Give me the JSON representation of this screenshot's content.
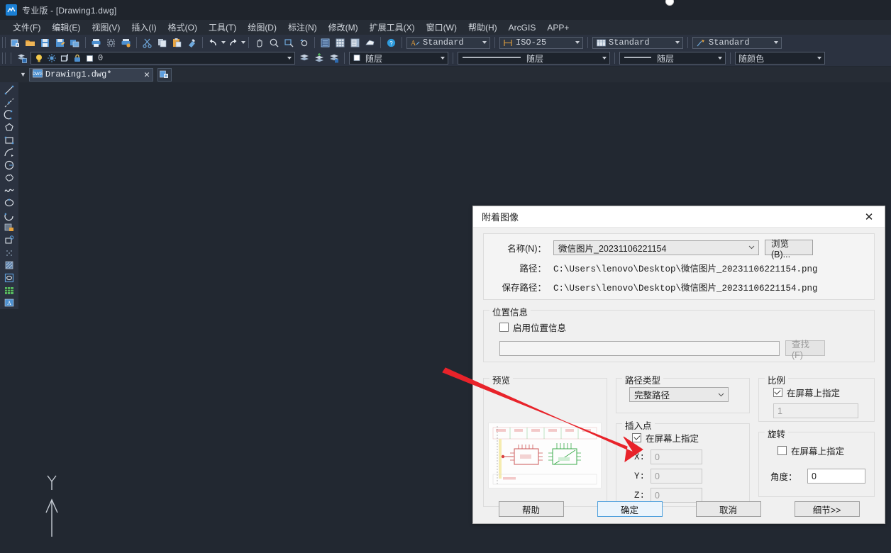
{
  "window": {
    "title": "专业版 - [Drawing1.dwg]",
    "app_icon": "cad-app-icon"
  },
  "menubar": {
    "items": [
      {
        "label": "文件(F)",
        "name": "menu-file"
      },
      {
        "label": "编辑(E)",
        "name": "menu-edit"
      },
      {
        "label": "视图(V)",
        "name": "menu-view"
      },
      {
        "label": "插入(I)",
        "name": "menu-insert"
      },
      {
        "label": "格式(O)",
        "name": "menu-format"
      },
      {
        "label": "工具(T)",
        "name": "menu-tools"
      },
      {
        "label": "绘图(D)",
        "name": "menu-draw"
      },
      {
        "label": "标注(N)",
        "name": "menu-dimension"
      },
      {
        "label": "修改(M)",
        "name": "menu-modify"
      },
      {
        "label": "扩展工具(X)",
        "name": "menu-express"
      },
      {
        "label": "窗口(W)",
        "name": "menu-window"
      },
      {
        "label": "帮助(H)",
        "name": "menu-help"
      },
      {
        "label": "ArcGIS",
        "name": "menu-arcgis"
      },
      {
        "label": "APP+",
        "name": "menu-appplus"
      }
    ]
  },
  "toolbar_styles": {
    "text_style": "Standard",
    "dim_style": "ISO-25",
    "table_style": "Standard",
    "mleader_style": "Standard"
  },
  "toolbar_props": {
    "layer": "0",
    "color": "随层",
    "linetype": "随层",
    "lineweight": "随层",
    "plotstyle": "随颜色"
  },
  "tabbar": {
    "document_name": "Drawing1.dwg*",
    "close_glyph": "✕"
  },
  "dialog": {
    "title": "附着图像",
    "close_glyph": "✕",
    "name_label": "名称(N)：",
    "name_value": "微信图片_20231106221154",
    "browse_button": "浏览(B)...",
    "path_label": "路径：",
    "path_value": "C:\\Users\\lenovo\\Desktop\\微信图片_20231106221154.png",
    "saved_path_label": "保存路径：",
    "saved_path_value": "C:\\Users\\lenovo\\Desktop\\微信图片_20231106221154.png",
    "geo_group_title": "位置信息",
    "geo_checkbox_label": "启用位置信息",
    "geo_checked": false,
    "geo_input_value": "",
    "geo_find_button": "查找(F)",
    "preview_group_title": "预览",
    "pathtype_group_title": "路径类型",
    "pathtype_value": "完整路径",
    "insertion_group_title": "插入点",
    "insertion_checkbox_label": "在屏幕上指定",
    "insertion_checked": true,
    "x_label": "X:",
    "x_value": "0",
    "y_label": "Y:",
    "y_value": "0",
    "z_label": "Z:",
    "z_value": "0",
    "scale_group_title": "比例",
    "scale_checkbox_label": "在屏幕上指定",
    "scale_checked": true,
    "scale_value": "1",
    "rotation_group_title": "旋转",
    "rotation_checkbox_label": "在屏幕上指定",
    "rotation_checked": false,
    "angle_label": "角度：",
    "angle_value": "0",
    "help_button": "帮助",
    "ok_button": "确定",
    "cancel_button": "取消",
    "details_button": "细节>>"
  },
  "canvas": {
    "ucs_y_label": "Y"
  },
  "colors": {
    "accent_blue": "#1a7fd4",
    "annotation_red": "#e8232a",
    "dialog_bg": "#f0f0f0",
    "canvas_bg": "#222831",
    "toolbar_bg": "#2b3240"
  }
}
